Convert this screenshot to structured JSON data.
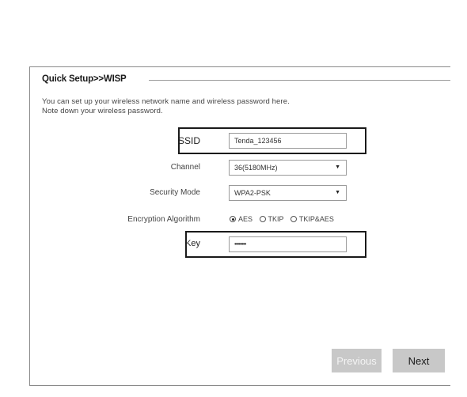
{
  "panel": {
    "title": "Quick Setup>>WISP",
    "intro_line1": "You can set up your wireless network name and wireless password here.",
    "intro_line2": "Note down your wireless password."
  },
  "form": {
    "ssid": {
      "label": "SSID",
      "value": "Tenda_123456"
    },
    "channel": {
      "label": "Channel",
      "value": "36(5180MHz)"
    },
    "security_mode": {
      "label": "Security Mode",
      "value": "WPA2-PSK"
    },
    "encryption": {
      "label": "Encryption Algorithm",
      "options": [
        "AES",
        "TKIP",
        "TKIP&AES"
      ],
      "selected": "AES"
    },
    "key": {
      "label": "Key",
      "value": "••••••••"
    }
  },
  "buttons": {
    "previous_label": "Previous",
    "next_label": "Next"
  },
  "colors": {
    "button_bg": "#c8c8c8",
    "highlight_border": "#1a1a1a"
  }
}
